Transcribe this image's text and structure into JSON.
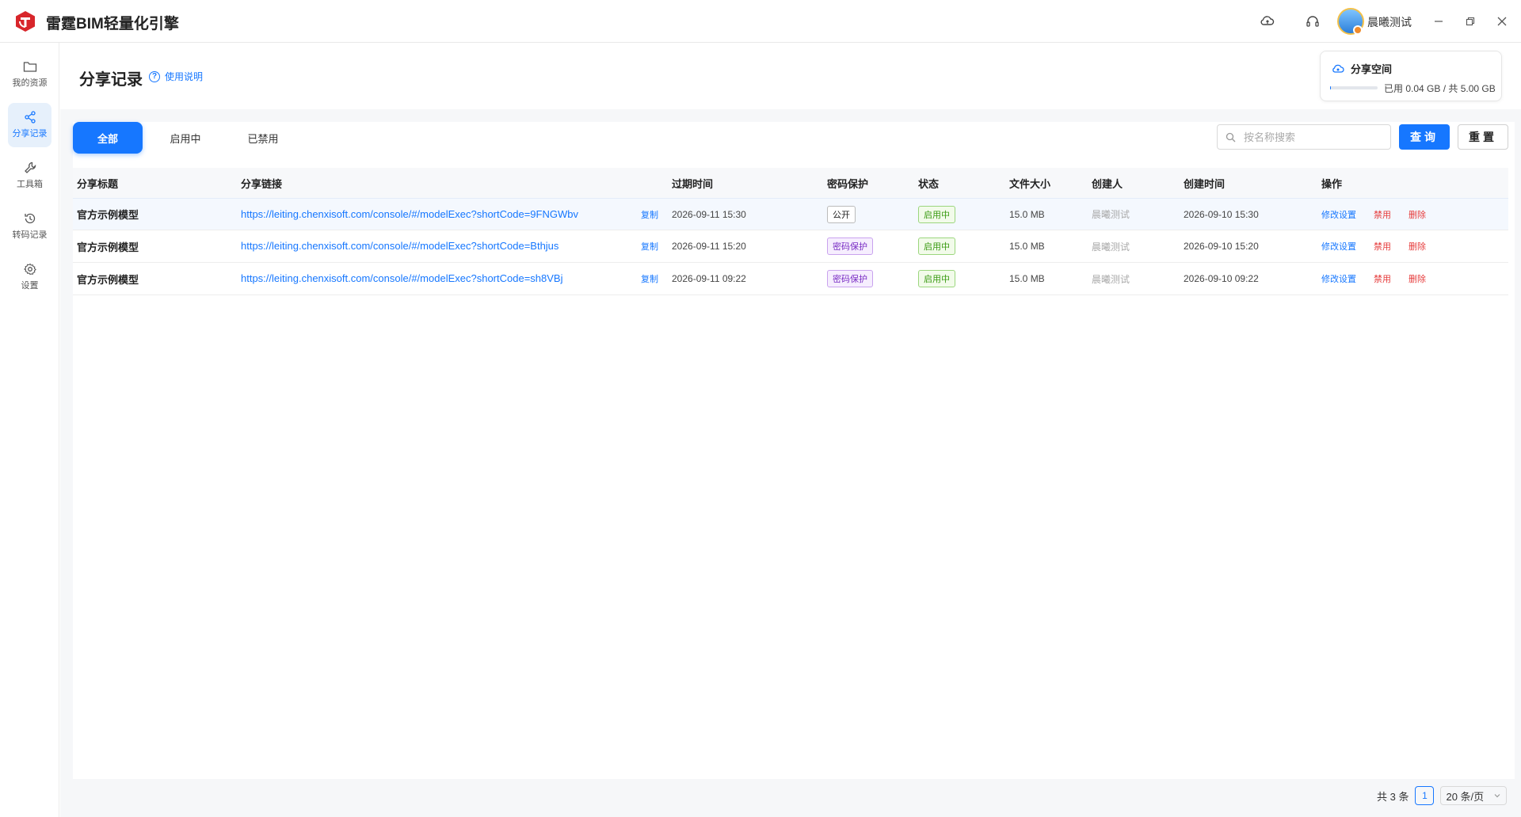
{
  "app": {
    "title": "雷霆BIM轻量化引擎"
  },
  "titlebar": {
    "user_name": "晨曦测试",
    "icons": [
      "cloud-sync-icon",
      "headset-icon",
      "minimize-icon",
      "restore-icon",
      "close-icon"
    ]
  },
  "sidebar": {
    "items": [
      {
        "label": "我的资源",
        "icon": "folder-icon",
        "active": false
      },
      {
        "label": "分享记录",
        "icon": "share-icon",
        "active": true
      },
      {
        "label": "工具箱",
        "icon": "wrench-icon",
        "active": false
      },
      {
        "label": "转码记录",
        "icon": "history-icon",
        "active": false
      },
      {
        "label": "设置",
        "icon": "gear-icon",
        "active": false
      }
    ]
  },
  "header": {
    "title": "分享记录",
    "help_label": "使用说明",
    "space": {
      "title": "分享空间",
      "usage_text": "已用 0.04 GB / 共 5.00 GB",
      "used_fraction": 0.008
    }
  },
  "tabs": [
    {
      "label": "全部",
      "active": true
    },
    {
      "label": "启用中",
      "active": false
    },
    {
      "label": "已禁用",
      "active": false
    }
  ],
  "search": {
    "placeholder": "按名称搜索",
    "value": "",
    "query_label": "查询",
    "reset_label": "重置"
  },
  "table": {
    "columns": [
      "分享标题",
      "分享链接",
      "过期时间",
      "密码保护",
      "状态",
      "文件大小",
      "创建人",
      "创建时间",
      "操作"
    ],
    "copy_label": "复制",
    "ops": {
      "edit": "修改设置",
      "disable": "禁用",
      "delete": "删除"
    },
    "rows": [
      {
        "title": "官方示例模型",
        "link": "https://leiting.chenxisoft.com/console/#/modelExec?shortCode=9FNGWbv",
        "expire": "2026-09-11 15:30",
        "pwd": "公开",
        "status": "启用中",
        "size": "15.0 MB",
        "creator": "晨曦测试",
        "created": "2026-09-10 15:30"
      },
      {
        "title": "官方示例模型",
        "link": "https://leiting.chenxisoft.com/console/#/modelExec?shortCode=Bthjus",
        "expire": "2026-09-11 15:20",
        "pwd": "密码保护",
        "status": "启用中",
        "size": "15.0 MB",
        "creator": "晨曦测试",
        "created": "2026-09-10 15:20"
      },
      {
        "title": "官方示例模型",
        "link": "https://leiting.chenxisoft.com/console/#/modelExec?shortCode=sh8VBj",
        "expire": "2026-09-11 09:22",
        "pwd": "密码保护",
        "status": "启用中",
        "size": "15.0 MB",
        "creator": "晨曦测试",
        "created": "2026-09-10 09:22"
      }
    ]
  },
  "pagination": {
    "total_text": "共 3 条",
    "current_page": "1",
    "page_size": "20 条/页"
  },
  "colors": {
    "accent": "#1677ff",
    "danger": "#e63c3c",
    "success": "#3a9b12",
    "purple": "#7a2ec4",
    "logo": "#d8262b"
  }
}
